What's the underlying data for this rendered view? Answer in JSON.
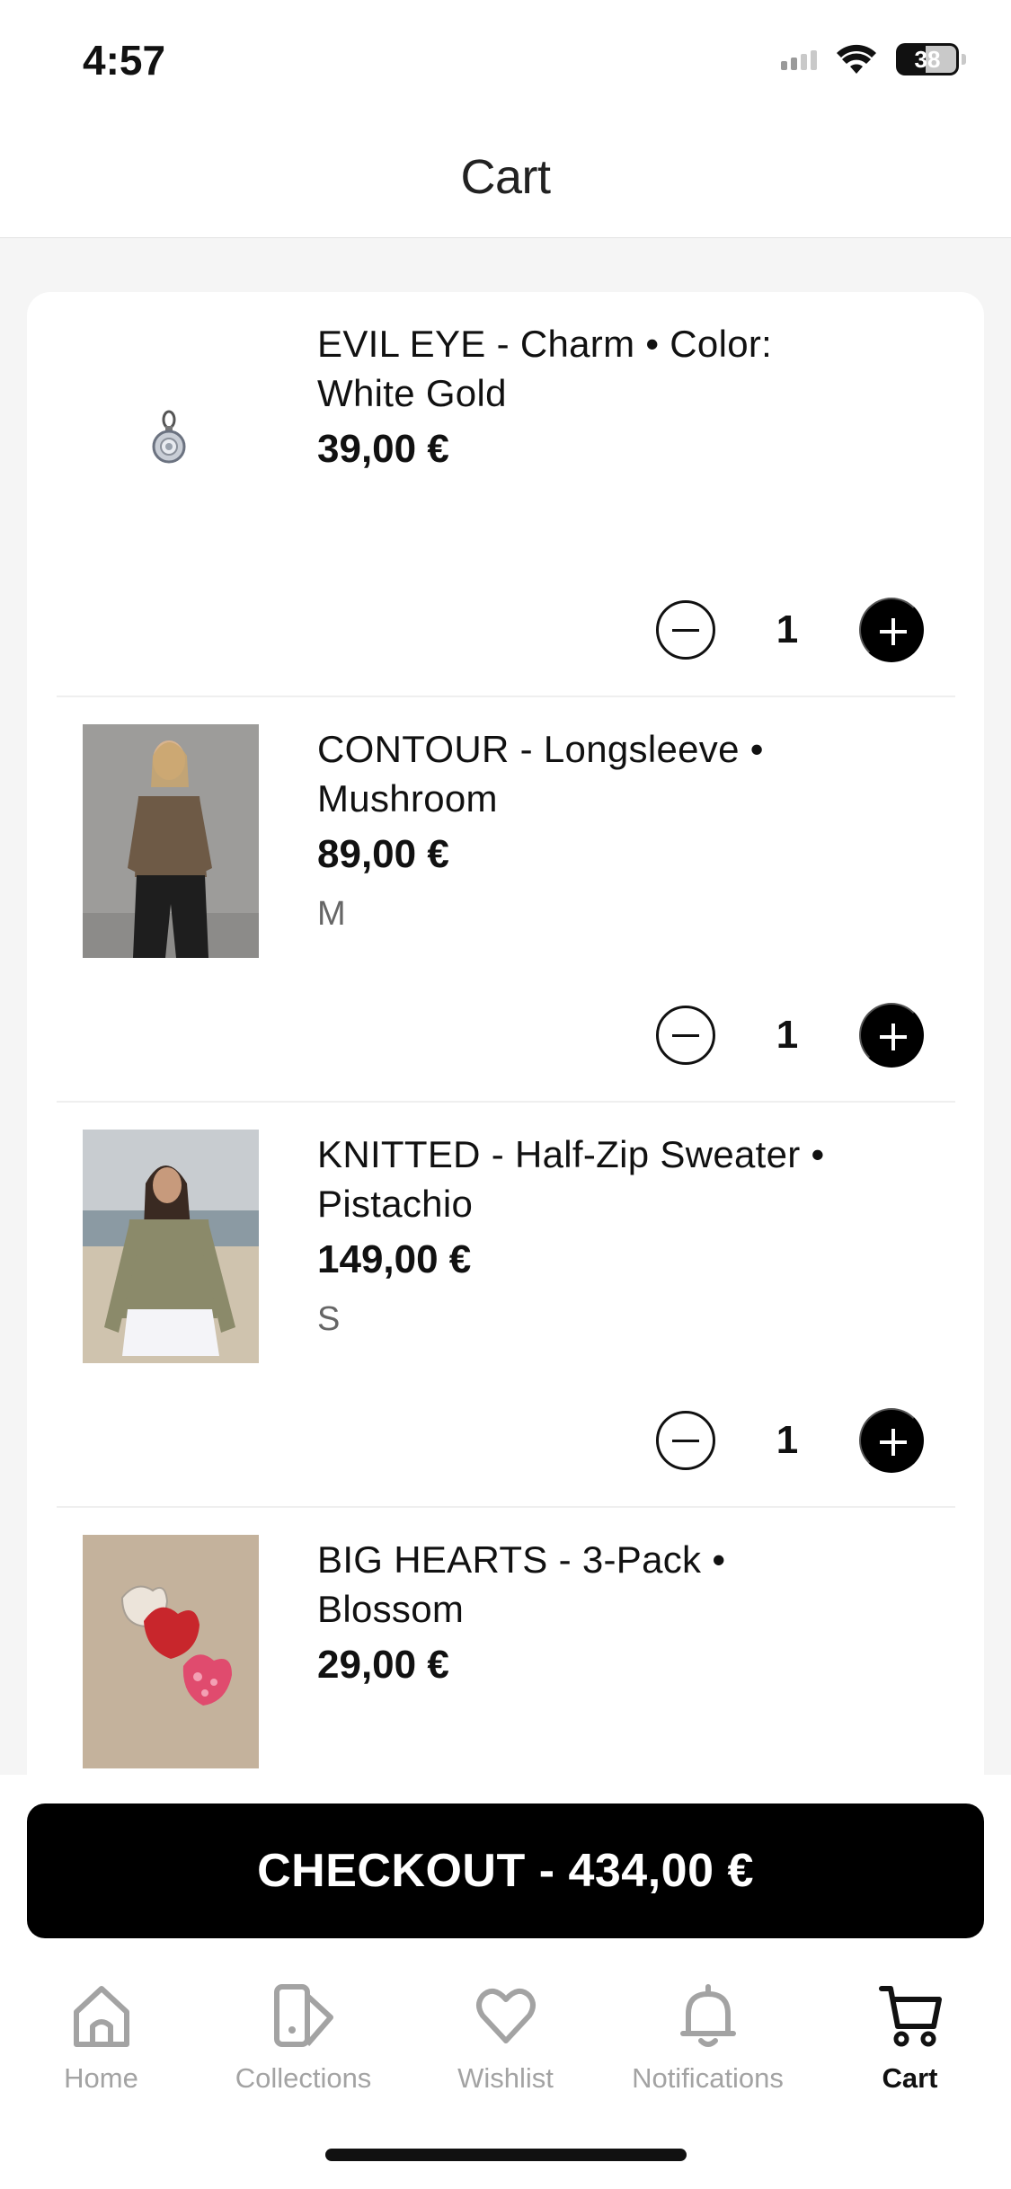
{
  "status_bar": {
    "time": "4:57",
    "battery": "38"
  },
  "header": {
    "title": "Cart"
  },
  "cart": {
    "items": [
      {
        "title": "EVIL EYE - Charm • Color: White Gold",
        "price": "39,00 €",
        "size": "",
        "quantity": "1",
        "image": "charm-image"
      },
      {
        "title": "CONTOUR - Longsleeve • Mushroom",
        "price": "89,00 €",
        "size": "M",
        "quantity": "1",
        "image": "longsleeve-image"
      },
      {
        "title": "KNITTED - Half-Zip Sweater • Pistachio",
        "price": "149,00 €",
        "size": "S",
        "quantity": "1",
        "image": "sweater-image"
      },
      {
        "title": "BIG HEARTS - 3-Pack • Blossom",
        "price": "29,00 €",
        "size": "",
        "quantity": "",
        "image": "hair-clips-image"
      }
    ]
  },
  "checkout": {
    "label": "CHECKOUT - 434,00 €"
  },
  "tab_bar": {
    "tabs": [
      {
        "label": "Home",
        "icon": "home-icon",
        "active": false
      },
      {
        "label": "Collections",
        "icon": "collections-icon",
        "active": false
      },
      {
        "label": "Wishlist",
        "icon": "heart-icon",
        "active": false
      },
      {
        "label": "Notifications",
        "icon": "bell-icon",
        "active": false
      },
      {
        "label": "Cart",
        "icon": "cart-icon",
        "active": true
      }
    ]
  },
  "colors": {
    "primary": "#000000",
    "background": "#f5f5f5",
    "inactive_tab": "#a3a3a3"
  }
}
